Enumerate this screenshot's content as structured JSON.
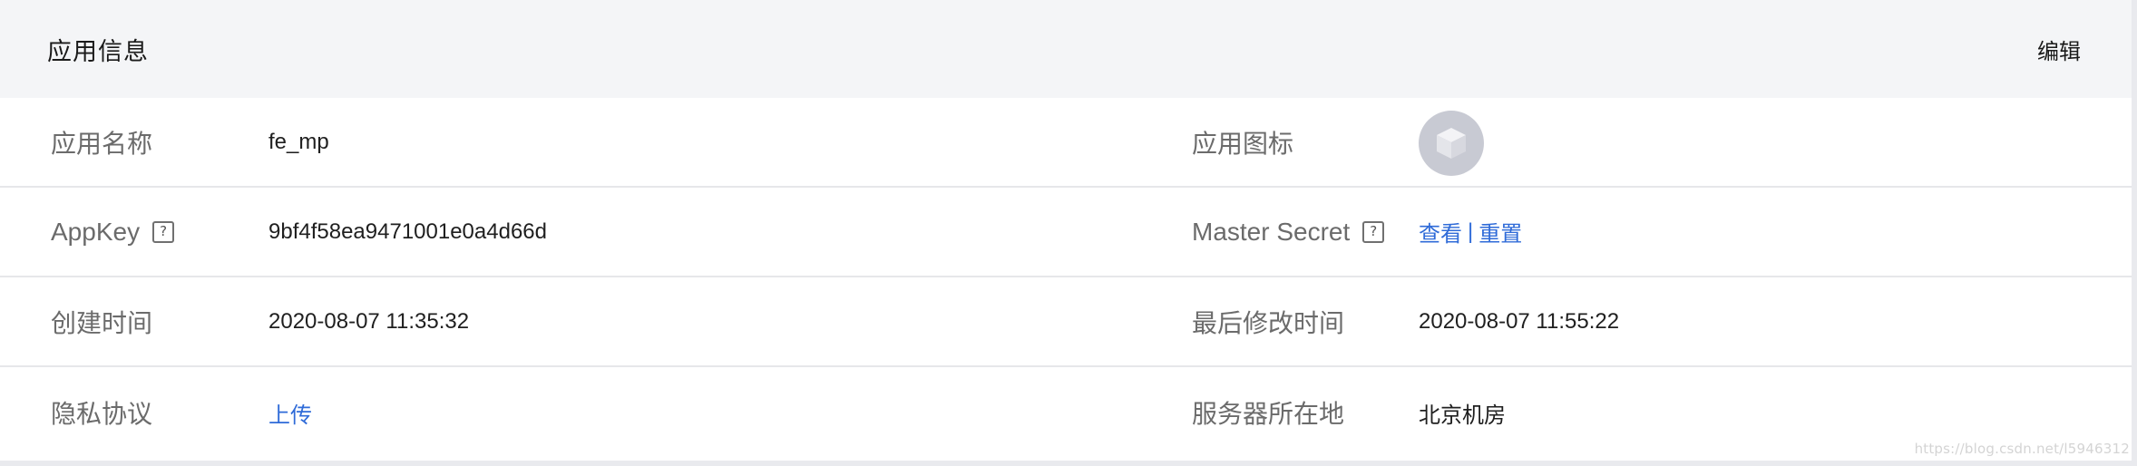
{
  "header": {
    "title": "应用信息",
    "edit_label": "编辑"
  },
  "rows": [
    {
      "left_label": "应用名称",
      "left_value": "fe_mp",
      "right_label": "应用图标",
      "right_icon": "app-cube-icon"
    },
    {
      "left_label": "AppKey",
      "left_help_icon": "question-icon",
      "left_value": "9bf4f58ea9471001e0a4d66d",
      "right_label": "Master Secret",
      "right_help_icon": "question-icon",
      "right_actions": [
        "查看",
        "重置"
      ],
      "right_separator": "|"
    },
    {
      "left_label": "创建时间",
      "left_value": "2020-08-07 11:35:32",
      "right_label": "最后修改时间",
      "right_value": "2020-08-07 11:55:22"
    },
    {
      "left_label": "隐私协议",
      "left_link": "上传",
      "right_label": "服务器所在地",
      "right_value": "北京机房"
    }
  ],
  "colors": {
    "header_bg": "#f4f5f7",
    "link": "#2f6bd8",
    "label": "#6b6b6b",
    "divider": "#e6e7ea",
    "icon_bg": "#c8cad3"
  },
  "watermark": "https://blog.csdn.net/l5946312"
}
